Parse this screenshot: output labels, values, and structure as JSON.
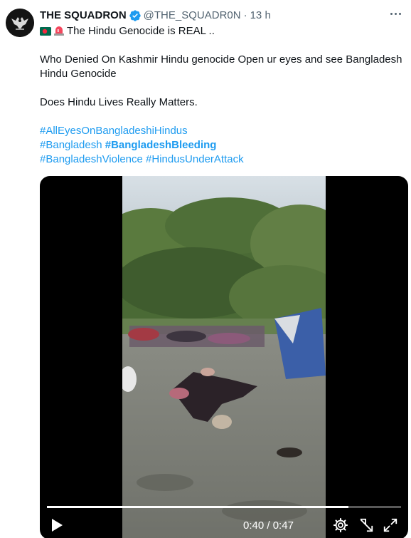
{
  "tweet": {
    "author": {
      "display_name": "THE SQUADRON",
      "handle": "@THE_SQUADR0N",
      "verified": true
    },
    "separator": "·",
    "time": "13 h",
    "lines": [
      "The Hindu Genocide is REAL ..",
      "",
      "Who Denied On Kashmir Hindu genocide Open ur eyes and see Bangladesh",
      "Hindu Genocide",
      "",
      "Does Hindu Lives Really Matters.",
      ""
    ],
    "hashtags": {
      "row1": [
        "#AllEyesOnBangladeshiHindus"
      ],
      "row2": [
        "#Bangladesh",
        "#BangladeshBleeding"
      ],
      "row3": [
        "#BangladeshViolence",
        "#HindusUnderAttack"
      ]
    }
  },
  "video": {
    "current_time": "0:40",
    "duration": "0:47",
    "time_separator": "/",
    "progress_fraction": 0.851
  },
  "colors": {
    "link": "#1d9bf0",
    "verified": "#1d9bf0",
    "secondary_text": "#536471",
    "flag_bd_green": "#006a4e",
    "flag_bd_red": "#f42a41"
  },
  "icons": {
    "verified": "verified-badge-icon",
    "more": "more-options-icon",
    "play": "play-icon",
    "settings": "gear-icon",
    "collapse": "collapse-icon",
    "fullscreen": "fullscreen-icon"
  }
}
